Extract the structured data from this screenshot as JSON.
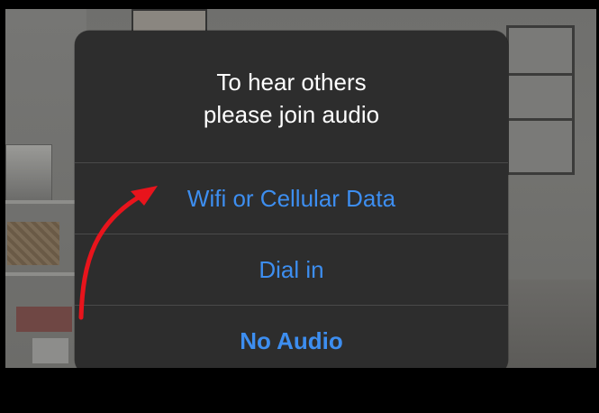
{
  "dialog": {
    "title_line1": "To hear others",
    "title_line2": "please join audio",
    "options": [
      {
        "label": "Wifi or Cellular Data",
        "bold": false
      },
      {
        "label": "Dial in",
        "bold": false
      },
      {
        "label": "No Audio",
        "bold": true
      }
    ]
  },
  "colors": {
    "dialog_bg": "#2d2d2d",
    "option_text": "#3d8ef0",
    "title_text": "#ffffff",
    "annotation_arrow": "#e8141c"
  }
}
